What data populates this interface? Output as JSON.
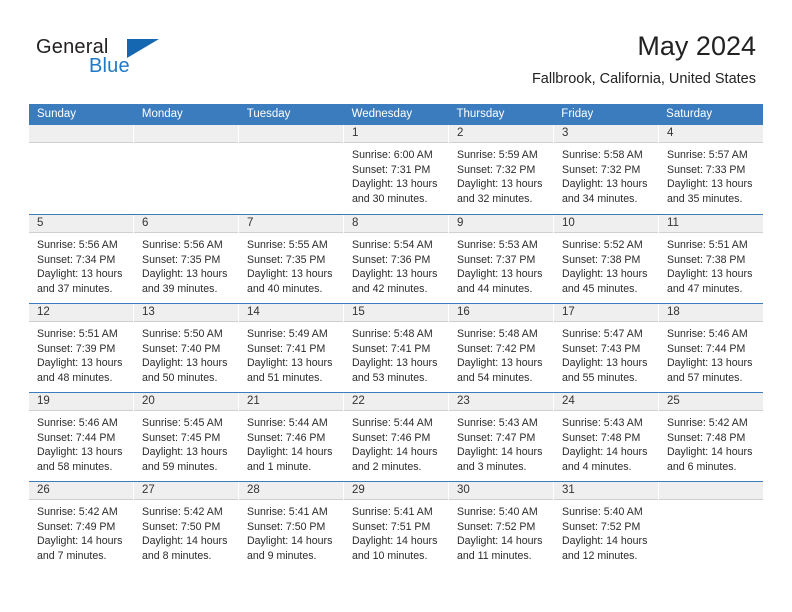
{
  "brand": {
    "word1": "General",
    "word2": "Blue",
    "logo_icon": "triangle-logo-icon"
  },
  "header": {
    "title": "May 2024",
    "subtitle": "Fallbrook, California, United States"
  },
  "colors": {
    "header_blue": "#3a7cbe",
    "brand_blue": "#2079c7",
    "daynum_strip": "#efefef"
  },
  "calendar": {
    "weekdays": [
      "Sunday",
      "Monday",
      "Tuesday",
      "Wednesday",
      "Thursday",
      "Friday",
      "Saturday"
    ],
    "weeks": [
      [
        {
          "day": "",
          "empty": true
        },
        {
          "day": "",
          "empty": true
        },
        {
          "day": "",
          "empty": true
        },
        {
          "day": "1",
          "sunrise": "Sunrise: 6:00 AM",
          "sunset": "Sunset: 7:31 PM",
          "daylight1": "Daylight: 13 hours",
          "daylight2": "and 30 minutes."
        },
        {
          "day": "2",
          "sunrise": "Sunrise: 5:59 AM",
          "sunset": "Sunset: 7:32 PM",
          "daylight1": "Daylight: 13 hours",
          "daylight2": "and 32 minutes."
        },
        {
          "day": "3",
          "sunrise": "Sunrise: 5:58 AM",
          "sunset": "Sunset: 7:32 PM",
          "daylight1": "Daylight: 13 hours",
          "daylight2": "and 34 minutes."
        },
        {
          "day": "4",
          "sunrise": "Sunrise: 5:57 AM",
          "sunset": "Sunset: 7:33 PM",
          "daylight1": "Daylight: 13 hours",
          "daylight2": "and 35 minutes."
        }
      ],
      [
        {
          "day": "5",
          "sunrise": "Sunrise: 5:56 AM",
          "sunset": "Sunset: 7:34 PM",
          "daylight1": "Daylight: 13 hours",
          "daylight2": "and 37 minutes."
        },
        {
          "day": "6",
          "sunrise": "Sunrise: 5:56 AM",
          "sunset": "Sunset: 7:35 PM",
          "daylight1": "Daylight: 13 hours",
          "daylight2": "and 39 minutes."
        },
        {
          "day": "7",
          "sunrise": "Sunrise: 5:55 AM",
          "sunset": "Sunset: 7:35 PM",
          "daylight1": "Daylight: 13 hours",
          "daylight2": "and 40 minutes."
        },
        {
          "day": "8",
          "sunrise": "Sunrise: 5:54 AM",
          "sunset": "Sunset: 7:36 PM",
          "daylight1": "Daylight: 13 hours",
          "daylight2": "and 42 minutes."
        },
        {
          "day": "9",
          "sunrise": "Sunrise: 5:53 AM",
          "sunset": "Sunset: 7:37 PM",
          "daylight1": "Daylight: 13 hours",
          "daylight2": "and 44 minutes."
        },
        {
          "day": "10",
          "sunrise": "Sunrise: 5:52 AM",
          "sunset": "Sunset: 7:38 PM",
          "daylight1": "Daylight: 13 hours",
          "daylight2": "and 45 minutes."
        },
        {
          "day": "11",
          "sunrise": "Sunrise: 5:51 AM",
          "sunset": "Sunset: 7:38 PM",
          "daylight1": "Daylight: 13 hours",
          "daylight2": "and 47 minutes."
        }
      ],
      [
        {
          "day": "12",
          "sunrise": "Sunrise: 5:51 AM",
          "sunset": "Sunset: 7:39 PM",
          "daylight1": "Daylight: 13 hours",
          "daylight2": "and 48 minutes."
        },
        {
          "day": "13",
          "sunrise": "Sunrise: 5:50 AM",
          "sunset": "Sunset: 7:40 PM",
          "daylight1": "Daylight: 13 hours",
          "daylight2": "and 50 minutes."
        },
        {
          "day": "14",
          "sunrise": "Sunrise: 5:49 AM",
          "sunset": "Sunset: 7:41 PM",
          "daylight1": "Daylight: 13 hours",
          "daylight2": "and 51 minutes."
        },
        {
          "day": "15",
          "sunrise": "Sunrise: 5:48 AM",
          "sunset": "Sunset: 7:41 PM",
          "daylight1": "Daylight: 13 hours",
          "daylight2": "and 53 minutes."
        },
        {
          "day": "16",
          "sunrise": "Sunrise: 5:48 AM",
          "sunset": "Sunset: 7:42 PM",
          "daylight1": "Daylight: 13 hours",
          "daylight2": "and 54 minutes."
        },
        {
          "day": "17",
          "sunrise": "Sunrise: 5:47 AM",
          "sunset": "Sunset: 7:43 PM",
          "daylight1": "Daylight: 13 hours",
          "daylight2": "and 55 minutes."
        },
        {
          "day": "18",
          "sunrise": "Sunrise: 5:46 AM",
          "sunset": "Sunset: 7:44 PM",
          "daylight1": "Daylight: 13 hours",
          "daylight2": "and 57 minutes."
        }
      ],
      [
        {
          "day": "19",
          "sunrise": "Sunrise: 5:46 AM",
          "sunset": "Sunset: 7:44 PM",
          "daylight1": "Daylight: 13 hours",
          "daylight2": "and 58 minutes."
        },
        {
          "day": "20",
          "sunrise": "Sunrise: 5:45 AM",
          "sunset": "Sunset: 7:45 PM",
          "daylight1": "Daylight: 13 hours",
          "daylight2": "and 59 minutes."
        },
        {
          "day": "21",
          "sunrise": "Sunrise: 5:44 AM",
          "sunset": "Sunset: 7:46 PM",
          "daylight1": "Daylight: 14 hours",
          "daylight2": "and 1 minute."
        },
        {
          "day": "22",
          "sunrise": "Sunrise: 5:44 AM",
          "sunset": "Sunset: 7:46 PM",
          "daylight1": "Daylight: 14 hours",
          "daylight2": "and 2 minutes."
        },
        {
          "day": "23",
          "sunrise": "Sunrise: 5:43 AM",
          "sunset": "Sunset: 7:47 PM",
          "daylight1": "Daylight: 14 hours",
          "daylight2": "and 3 minutes."
        },
        {
          "day": "24",
          "sunrise": "Sunrise: 5:43 AM",
          "sunset": "Sunset: 7:48 PM",
          "daylight1": "Daylight: 14 hours",
          "daylight2": "and 4 minutes."
        },
        {
          "day": "25",
          "sunrise": "Sunrise: 5:42 AM",
          "sunset": "Sunset: 7:48 PM",
          "daylight1": "Daylight: 14 hours",
          "daylight2": "and 6 minutes."
        }
      ],
      [
        {
          "day": "26",
          "sunrise": "Sunrise: 5:42 AM",
          "sunset": "Sunset: 7:49 PM",
          "daylight1": "Daylight: 14 hours",
          "daylight2": "and 7 minutes."
        },
        {
          "day": "27",
          "sunrise": "Sunrise: 5:42 AM",
          "sunset": "Sunset: 7:50 PM",
          "daylight1": "Daylight: 14 hours",
          "daylight2": "and 8 minutes."
        },
        {
          "day": "28",
          "sunrise": "Sunrise: 5:41 AM",
          "sunset": "Sunset: 7:50 PM",
          "daylight1": "Daylight: 14 hours",
          "daylight2": "and 9 minutes."
        },
        {
          "day": "29",
          "sunrise": "Sunrise: 5:41 AM",
          "sunset": "Sunset: 7:51 PM",
          "daylight1": "Daylight: 14 hours",
          "daylight2": "and 10 minutes."
        },
        {
          "day": "30",
          "sunrise": "Sunrise: 5:40 AM",
          "sunset": "Sunset: 7:52 PM",
          "daylight1": "Daylight: 14 hours",
          "daylight2": "and 11 minutes."
        },
        {
          "day": "31",
          "sunrise": "Sunrise: 5:40 AM",
          "sunset": "Sunset: 7:52 PM",
          "daylight1": "Daylight: 14 hours",
          "daylight2": "and 12 minutes."
        },
        {
          "day": "",
          "empty": true
        }
      ]
    ]
  }
}
